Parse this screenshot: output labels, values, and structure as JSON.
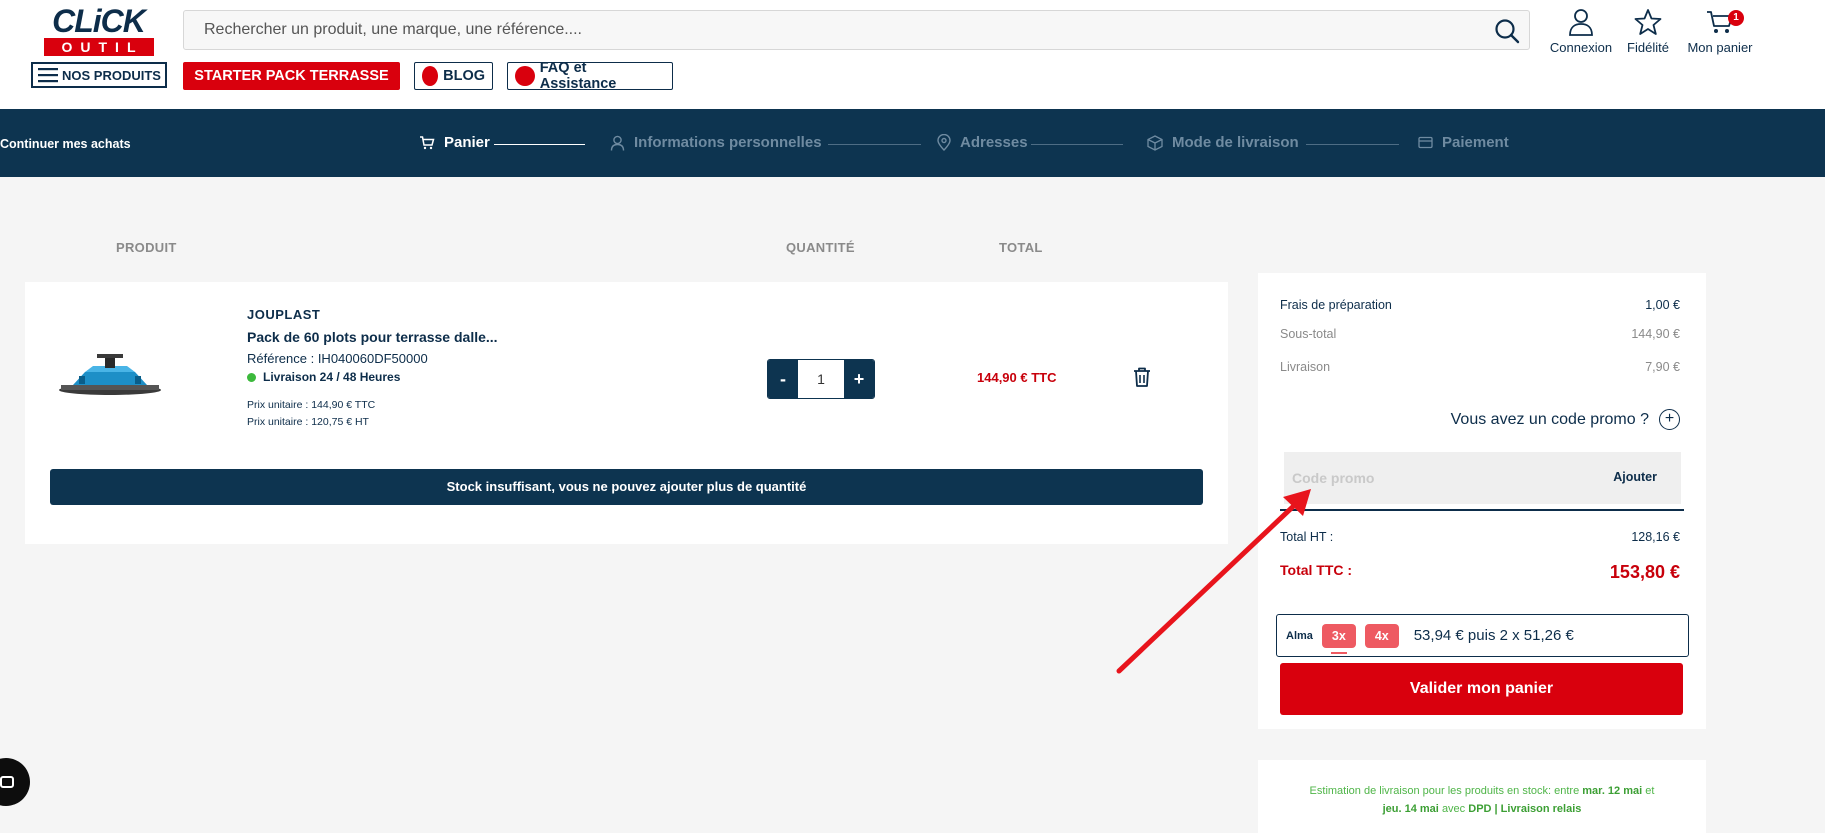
{
  "header": {
    "logo_top": "CLiCK",
    "logo_bottom": "OUTIL",
    "search_placeholder": "Rechercher un produit, une marque, une référence....",
    "links": {
      "account": "Connexion",
      "loyalty": "Fidélité",
      "cart": "Mon panier",
      "cart_count": "1"
    },
    "nav": {
      "products": "NOS PRODUITS",
      "starter": "STARTER PACK TERRASSE",
      "blog": "BLOG",
      "faq": "FAQ et Assistance"
    }
  },
  "steps": {
    "continue": "Continuer mes achats",
    "items": [
      "Panier",
      "Informations personnelles",
      "Adresses",
      "Mode de livraison",
      "Paiement"
    ]
  },
  "table": {
    "headers": [
      "PRODUIT",
      "QUANTITÉ",
      "TOTAL"
    ]
  },
  "product": {
    "brand": "JOUPLAST",
    "name": "Pack de 60 plots pour terrasse dalle...",
    "reference": "Référence : IH040060DF50000",
    "delivery": "Livraison 24 / 48 Heures",
    "unit_ttc": "Prix unitaire : 144,90 € TTC",
    "unit_ht": "Prix unitaire : 120,75 € HT",
    "quantity": "1",
    "total": "144,90 € TTC",
    "stock_warning": "Stock insuffisant, vous ne pouvez ajouter plus de quantité"
  },
  "summary": {
    "prep_label": "Frais de préparation",
    "prep_value": "1,00 €",
    "subtotal_label": "Sous-total",
    "subtotal_value": "144,90 €",
    "shipping_label": "Livraison",
    "shipping_value": "7,90 €",
    "promo_question": "Vous avez un code promo ?",
    "promo_placeholder": "Code promo",
    "promo_add": "Ajouter",
    "total_ht_label": "Total HT :",
    "total_ht_value": "128,16 €",
    "total_ttc_label": "Total TTC :",
    "total_ttc_value": "153,80 €",
    "alma": {
      "logo": "Alma",
      "options": [
        "3x",
        "4x"
      ],
      "selected": "3x",
      "text": "53,94 € puis 2 x 51,26 €"
    },
    "validate": "Valider mon panier"
  },
  "estimate": {
    "prefix": "Estimation de livraison pour les produits en stock: entre",
    "date_start": "mar. 12 mai",
    "connector": "et",
    "date_end": "jeu. 14 mai",
    "with": "avec",
    "carrier": "DPD | Livraison relais"
  },
  "colors": {
    "navy": "#0d3450",
    "red": "#d9000d",
    "green": "#3cb93c",
    "alma_pink": "#ee5a62",
    "annotation_arrow": "#e8141c"
  }
}
